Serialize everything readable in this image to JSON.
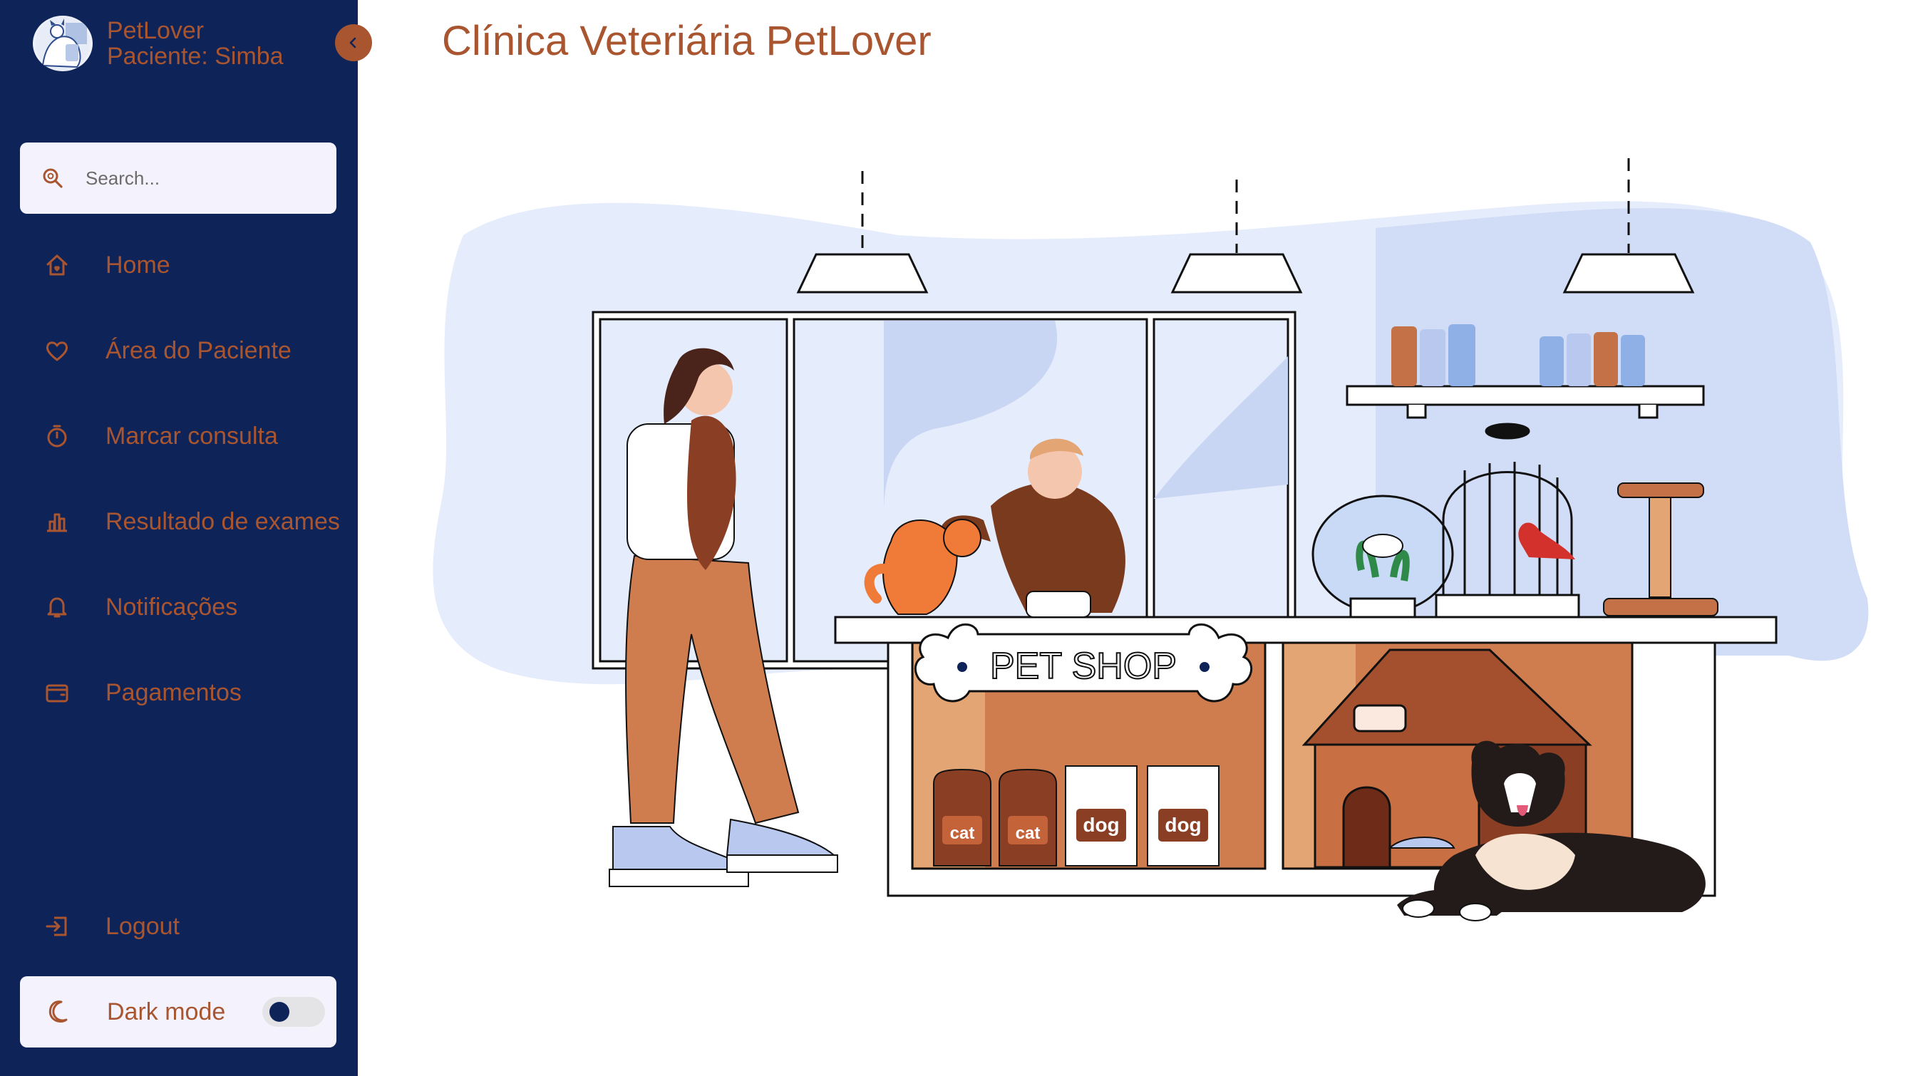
{
  "sidebar": {
    "brand": {
      "name": "PetLover",
      "patient": "Paciente: Simba",
      "logo_icon": "pet-clinic-logo"
    },
    "collapse_icon": "chevron-left-icon",
    "search": {
      "placeholder": "Search..."
    },
    "items": [
      {
        "label": "Home",
        "icon": "home-icon"
      },
      {
        "label": "Área do Paciente",
        "icon": "heart-icon"
      },
      {
        "label": "Marcar consulta",
        "icon": "timer-icon"
      },
      {
        "label": "Resultado de exames",
        "icon": "bar-chart-icon"
      },
      {
        "label": "Notificações",
        "icon": "bell-icon"
      },
      {
        "label": "Pagamentos",
        "icon": "wallet-icon"
      }
    ],
    "logout": {
      "label": "Logout",
      "icon": "logout-icon"
    },
    "dark_mode": {
      "label": "Dark mode",
      "icon": "moon-icon",
      "enabled": false
    }
  },
  "main": {
    "title": "Clínica Veteriária PetLover",
    "illustration": {
      "sign": "PET SHOP",
      "bag_labels": [
        "cat",
        "cat",
        "dog",
        "dog"
      ]
    }
  },
  "colors": {
    "sidebar_bg": "#0e2459",
    "accent": "#a85530",
    "panel_bg": "#f4f3fd",
    "page_bg": "#ffffff"
  }
}
